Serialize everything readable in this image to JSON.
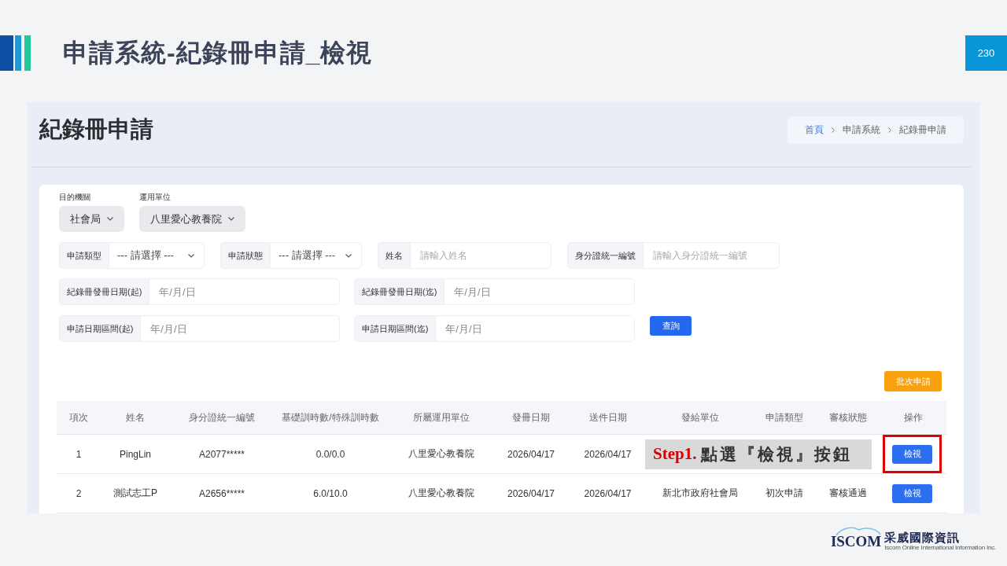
{
  "slide": {
    "title": "申請系統-紀錄冊申請_檢視",
    "page_number": "230"
  },
  "page": {
    "title": "紀錄冊申請",
    "breadcrumb": [
      {
        "label": "首頁",
        "kind": "link"
      },
      {
        "label": "申請系統",
        "kind": "text"
      },
      {
        "label": "紀錄冊申請",
        "kind": "text"
      }
    ]
  },
  "filters": {
    "selects": [
      {
        "label": "目的機關",
        "value": "社會局"
      },
      {
        "label": "運用單位",
        "value": "八里愛心教養院"
      }
    ],
    "rows": [
      [
        {
          "kind": "select",
          "label": "申請類型",
          "value": "--- 請選擇 ---"
        },
        {
          "kind": "select",
          "label": "申請狀態",
          "value": "--- 請選擇 ---"
        },
        {
          "kind": "text",
          "label": "姓名",
          "placeholder": "請輸入姓名"
        },
        {
          "kind": "text",
          "label": "身分證統一編號",
          "placeholder": "請輸入身分證統一編號"
        }
      ],
      [
        {
          "kind": "date",
          "label": "紀錄冊發冊日期(起)",
          "placeholder": "年/月/日"
        },
        {
          "kind": "date",
          "label": "紀錄冊發冊日期(迄)",
          "placeholder": "年/月/日"
        }
      ],
      [
        {
          "kind": "date",
          "label": "申請日期區間(起)",
          "placeholder": "年/月/日"
        },
        {
          "kind": "date",
          "label": "申請日期區間(迄)",
          "placeholder": "年/月/日"
        }
      ]
    ],
    "search_button": "查詢"
  },
  "batch_button": "批次申請",
  "table": {
    "columns": [
      "項次",
      "姓名",
      "身分證統一編號",
      "基礎訓時數/特殊訓時數",
      "所屬運用單位",
      "發冊日期",
      "送件日期",
      "發給單位",
      "申請類型",
      "審核狀態",
      "操作"
    ],
    "rows": [
      {
        "cells": [
          "1",
          "PingLin",
          "A2077*****",
          "0.0/0.0",
          "八里愛心教養院",
          "2026/04/17",
          "2026/04/17"
        ],
        "annotation": {
          "step": "Step1.",
          "text": "點選『檢視』按鈕"
        },
        "action": "檢視",
        "highlighted": true
      },
      {
        "cells": [
          "2",
          "測試志工P",
          "A2656*****",
          "6.0/10.0",
          "八里愛心教養院",
          "2026/04/17",
          "2026/04/17",
          "新北市政府社會局",
          "初次申請",
          "審核通過"
        ],
        "action": "檢視",
        "highlighted": false
      }
    ]
  },
  "logo": {
    "wordmark": "ISCOM",
    "name": "采威國際資訊",
    "tagline": "Iscom Online International Information Inc."
  }
}
